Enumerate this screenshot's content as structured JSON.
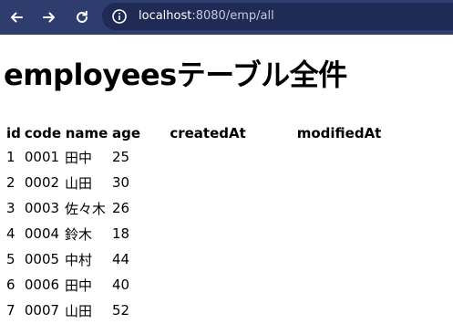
{
  "browser": {
    "url_host": "localhost",
    "url_rest": ":8080/emp/all"
  },
  "page": {
    "title": "employeesテーブル全件"
  },
  "table": {
    "headers": [
      "id",
      "code",
      "name",
      "age",
      "createdAt",
      "modifiedAt"
    ],
    "rows": [
      {
        "id": "1",
        "code": "0001",
        "name": "田中",
        "age": "25",
        "createdAt": "",
        "modifiedAt": ""
      },
      {
        "id": "2",
        "code": "0002",
        "name": "山田",
        "age": "30",
        "createdAt": "",
        "modifiedAt": ""
      },
      {
        "id": "3",
        "code": "0003",
        "name": "佐々木",
        "age": "26",
        "createdAt": "",
        "modifiedAt": ""
      },
      {
        "id": "4",
        "code": "0004",
        "name": "鈴木",
        "age": "18",
        "createdAt": "",
        "modifiedAt": ""
      },
      {
        "id": "5",
        "code": "0005",
        "name": "中村",
        "age": "44",
        "createdAt": "",
        "modifiedAt": ""
      },
      {
        "id": "6",
        "code": "0006",
        "name": "田中",
        "age": "40",
        "createdAt": "",
        "modifiedAt": ""
      },
      {
        "id": "7",
        "code": "0007",
        "name": "山田",
        "age": "52",
        "createdAt": "",
        "modifiedAt": ""
      }
    ]
  },
  "icons": {
    "back": "arrow-left-icon",
    "forward": "arrow-right-icon",
    "reload": "reload-icon",
    "site_info": "site-info-icon"
  },
  "colors": {
    "toolbar": "#2f3c6e",
    "omnibox": "#1f2a55",
    "icon": "#ffffff"
  }
}
